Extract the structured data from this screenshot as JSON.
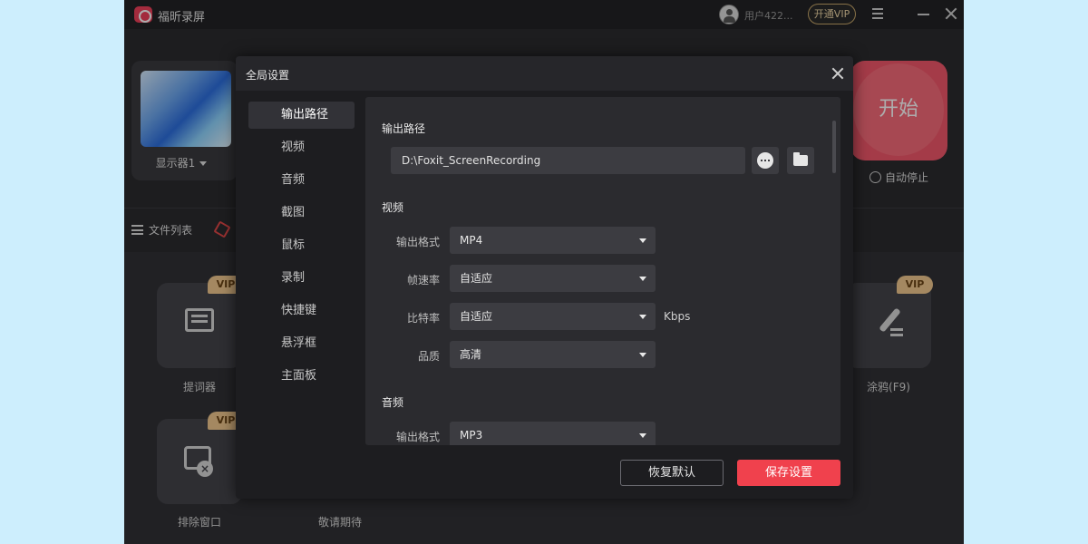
{
  "app": {
    "title": "福昕录屏",
    "user_name": "用户422...",
    "vip_button": "开通VIP",
    "monitor_label": "显示器1",
    "start_label": "开始",
    "auto_stop": "自动停止",
    "file_list": "文件列表",
    "tools": [
      {
        "label": "提词器",
        "vip": "VIP"
      },
      {
        "label": "涂鸦(F9)",
        "vip": "VIP"
      },
      {
        "label": "排除窗口",
        "vip": "VIP"
      },
      {
        "label": "敬请期待"
      }
    ]
  },
  "dialog": {
    "title": "全局设置",
    "nav": [
      "输出路径",
      "视频",
      "音频",
      "截图",
      "鼠标",
      "录制",
      "快捷键",
      "悬浮框",
      "主面板"
    ],
    "active_nav": "输出路径",
    "output_path": {
      "title": "输出路径",
      "value": "D:\\Foxit_ScreenRecording"
    },
    "video": {
      "title": "视频",
      "rows": [
        {
          "label": "输出格式",
          "value": "MP4"
        },
        {
          "label": "帧速率",
          "value": "自适应"
        },
        {
          "label": "比特率",
          "value": "自适应",
          "unit": "Kbps"
        },
        {
          "label": "品质",
          "value": "高清"
        }
      ]
    },
    "audio": {
      "title": "音频",
      "rows": [
        {
          "label": "输出格式",
          "value": "MP3"
        }
      ]
    },
    "buttons": {
      "reset": "恢复默认",
      "save": "保存设置"
    }
  },
  "colors": {
    "accent": "#f0414d",
    "vip_gold": "#f2c98f",
    "panel_bg": "#1d1d20"
  }
}
